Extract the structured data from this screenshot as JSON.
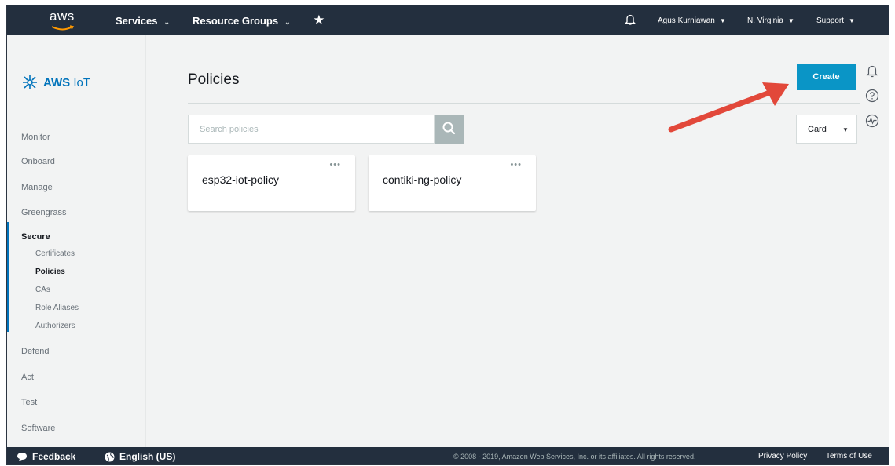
{
  "topnav": {
    "logo": "aws",
    "services": "Services",
    "resource_groups": "Resource Groups",
    "user": "Agus Kurniawan",
    "region": "N. Virginia",
    "support": "Support"
  },
  "sidebar": {
    "brand_strong": "AWS",
    "brand_light": "IoT",
    "items": {
      "monitor": "Monitor",
      "onboard": "Onboard",
      "manage": "Manage",
      "greengrass": "Greengrass",
      "secure": "Secure",
      "defend": "Defend",
      "act": "Act",
      "test": "Test",
      "software": "Software"
    },
    "secure_sub": [
      "Certificates",
      "Policies",
      "CAs",
      "Role Aliases",
      "Authorizers"
    ],
    "active_sub": "Policies"
  },
  "main": {
    "title": "Policies",
    "create_label": "Create",
    "search_placeholder": "Search policies",
    "view_select": "Card",
    "cards": [
      {
        "name": "esp32-iot-policy"
      },
      {
        "name": "contiki-ng-policy"
      }
    ]
  },
  "footer": {
    "feedback": "Feedback",
    "language": "English (US)",
    "copyright": "© 2008 - 2019, Amazon Web Services, Inc. or its affiliates. All rights reserved.",
    "privacy": "Privacy Policy",
    "terms": "Terms of Use"
  },
  "colors": {
    "nav_bg": "#232f3e",
    "accent": "#0073bb",
    "create_button": "#0a95c6",
    "annotation_arrow": "#e2483a"
  }
}
